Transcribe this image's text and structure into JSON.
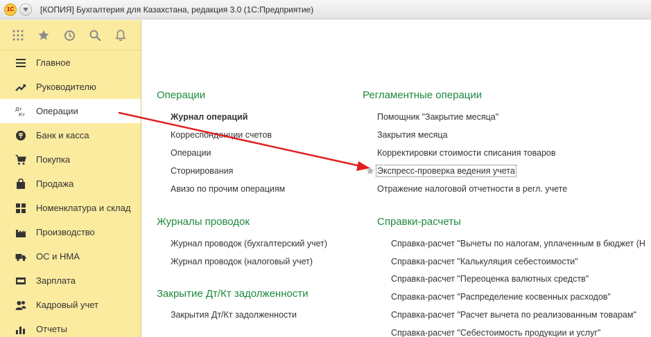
{
  "window": {
    "logo_text": "1С",
    "title": "[КОПИЯ] Бухгалтерия для Казахстана, редакция 3.0  (1С:Предприятие)"
  },
  "sidebar": {
    "items": [
      {
        "label": "Главное",
        "icon": "menu-lines-icon"
      },
      {
        "label": "Руководителю",
        "icon": "trend-icon"
      },
      {
        "label": "Операции",
        "icon": "debit-credit-icon"
      },
      {
        "label": "Банк и касса",
        "icon": "coin-icon"
      },
      {
        "label": "Покупка",
        "icon": "cart-icon"
      },
      {
        "label": "Продажа",
        "icon": "shopping-bag-icon"
      },
      {
        "label": "Номенклатура и склад",
        "icon": "grid-icon"
      },
      {
        "label": "Производство",
        "icon": "factory-icon"
      },
      {
        "label": "ОС и НМА",
        "icon": "truck-icon"
      },
      {
        "label": "Зарплата",
        "icon": "salary-icon"
      },
      {
        "label": "Кадровый учет",
        "icon": "people-icon"
      },
      {
        "label": "Отчеты",
        "icon": "bar-chart-icon"
      }
    ],
    "active_index": 2
  },
  "main": {
    "operations": {
      "title": "Операции",
      "links": [
        "Журнал операций",
        "Корреспонденции счетов",
        "Операции",
        "Сторнирования",
        "Авизо по прочим операциям"
      ]
    },
    "journals": {
      "title": "Журналы проводок",
      "links": [
        "Журнал проводок (бухгалтерский учет)",
        "Журнал проводок (налоговый учет)"
      ]
    },
    "closing": {
      "title": "Закрытие Дт/Кт задолженности",
      "links": [
        "Закрытия Дт/Кт задолженности"
      ]
    },
    "regulatory": {
      "title": "Регламентные операции",
      "links": [
        "Помощник \"Закрытие месяца\"",
        "Закрытия месяца",
        "Корректировки стоимости списания товаров",
        "Экспресс-проверка ведения учета",
        "Отражение налоговой отчетности в регл. учете"
      ]
    },
    "reports": {
      "title": "Справки-расчеты",
      "links": [
        "Справка-расчет \"Вычеты по налогам, уплаченным в бюджет (Н",
        "Справка-расчет \"Калькуляция себестоимости\"",
        "Справка-расчет \"Переоценка валютных средств\"",
        "Справка-расчет \"Распределение косвенных расходов\"",
        "Справка-расчет \"Расчет вычета  по реализованным товарам\"",
        "Справка-расчет \"Себестоимость продукции и услуг\""
      ]
    }
  },
  "colors": {
    "sidebar_bg": "#fbeb9f",
    "section_title": "#1d8a3c",
    "arrow": "#e02020"
  }
}
